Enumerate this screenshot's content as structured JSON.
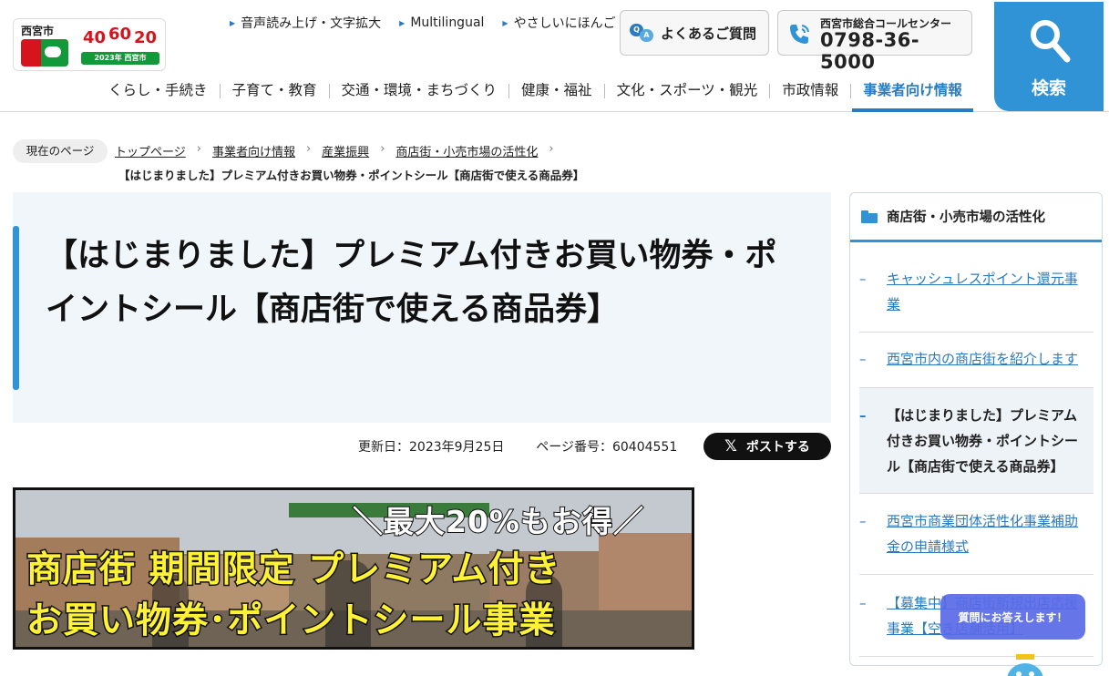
{
  "header": {
    "logo": {
      "city_name": "西宮市",
      "anniversary_left": "40",
      "anniversary_mid": "60",
      "anniversary_right": "20",
      "anniversary_bottom": "2023年 西宮市"
    },
    "util_links": [
      "音声読み上げ・文字拡大",
      "Multilingual",
      "やさしいにほんご"
    ],
    "faq_label": "よくあるご質問",
    "call_center_label": "西宮市総合コールセンター",
    "call_center_number": "0798-36-5000",
    "search_label": "検索",
    "global_nav": [
      "くらし・手続き",
      "子育て・教育",
      "交通・環境・まちづくり",
      "健康・福祉",
      "文化・スポーツ・観光",
      "市政情報",
      "事業者向け情報"
    ],
    "active_nav": "事業者向け情報"
  },
  "breadcrumb": {
    "label": "現在のページ",
    "items": [
      "トップページ",
      "事業者向け情報",
      "産業振興",
      "商店街・小売市場の活性化"
    ],
    "current": "【はじまりました】プレミアム付きお買い物券・ポイントシール【商店街で使える商品券】"
  },
  "page": {
    "title": "【はじまりました】プレミアム付きお買い物券・ポイントシール【商店街で使える商品券】",
    "updated": "更新日：2023年9月25日",
    "page_number": "ページ番号：60404551",
    "post_label": "ポストする"
  },
  "banner": {
    "line1": "＼最大20%もお得／",
    "line2": "商店街 期間限定 プレミアム付き",
    "line3": "お買い物券･ポイントシール事業"
  },
  "sidebar": {
    "heading": "商店街・小売市場の活性化",
    "items": [
      {
        "label": "キャッシュレスポイント還元事業",
        "current": false
      },
      {
        "label": "西宮市内の商店街を紹介します",
        "current": false
      },
      {
        "label": "【はじまりました】プレミアム付きお買い物券・ポイントシール【商店街で使える商品券】",
        "current": true
      },
      {
        "label": "西宮市商業団体活性化事業補助金の申請様式",
        "current": false
      },
      {
        "label": "【募集中】商店街新規出店応援事業【空き店舗活用】",
        "current": false
      }
    ]
  },
  "chat": {
    "label": "質問にお答えします！"
  },
  "colors": {
    "accent": "#2f93d6",
    "link": "#2a7bbf",
    "logo_red": "#d6141d",
    "logo_green": "#129a3a",
    "chat": "#5a6be8"
  }
}
